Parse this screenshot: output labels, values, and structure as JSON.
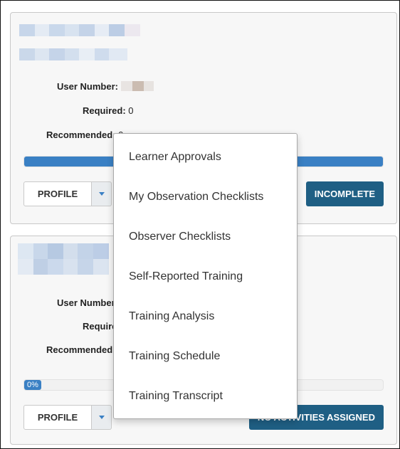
{
  "cards": [
    {
      "user_number_label": "User Number:",
      "required_label": "Required:",
      "required_value": "0",
      "recommended_label": "Recommended:",
      "recommended_value": "0",
      "progress_percent": 100,
      "profile_label": "PROFILE",
      "status_label": "INCOMPLETE"
    },
    {
      "user_number_label": "User Number:",
      "required_label": "Required:",
      "recommended_label": "Recommended:",
      "progress_percent": 0,
      "progress_text": "0%",
      "profile_label": "PROFILE",
      "status_label": "NO ACTIVITIES ASSIGNED"
    }
  ],
  "dropdown": {
    "items": [
      {
        "label": "Learner Approvals"
      },
      {
        "label": "My Observation Checklists"
      },
      {
        "label": "Observer Checklists"
      },
      {
        "label": "Self-Reported Training"
      },
      {
        "label": "Training Analysis"
      },
      {
        "label": "Training Schedule"
      },
      {
        "label": "Training Transcript"
      }
    ]
  },
  "colors": {
    "accent": "#3a80c4",
    "status_button": "#1f5f84",
    "card_background": "#f7f7f7"
  }
}
